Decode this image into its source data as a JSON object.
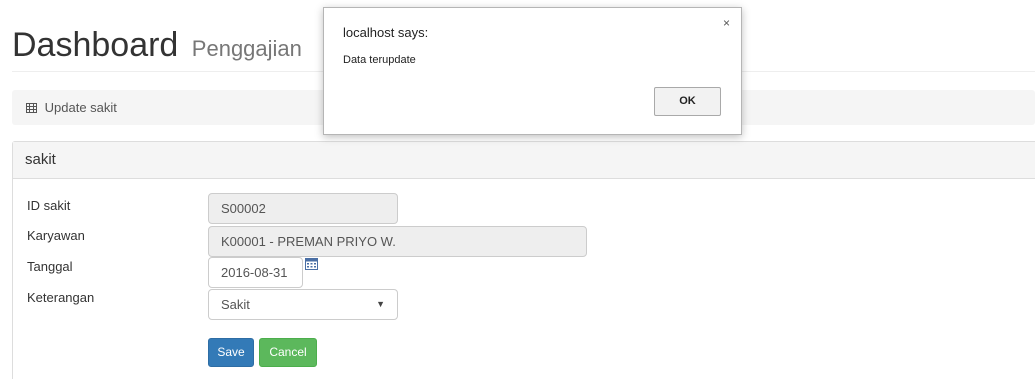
{
  "header": {
    "title": "Dashboard",
    "subtitle": "Penggajian"
  },
  "breadcrumb": {
    "icon": "table-icon",
    "label": "Update sakit"
  },
  "panel": {
    "heading": "sakit"
  },
  "form": {
    "id_label": "ID sakit",
    "id_value": "S00002",
    "karyawan_label": "Karyawan",
    "karyawan_value": "K00001 - PREMAN PRIYO W.",
    "tanggal_label": "Tanggal",
    "tanggal_value": "2016-08-31",
    "keterangan_label": "Keterangan",
    "keterangan_value": "Sakit",
    "save_label": "Save",
    "cancel_label": "Cancel"
  },
  "dialog": {
    "title": "localhost says:",
    "message": "Data terupdate",
    "ok_label": "OK",
    "close_symbol": "×"
  },
  "colors": {
    "save_button": "#337ab7",
    "cancel_button": "#5cb85c",
    "panel_heading_bg": "#f5f5f5"
  }
}
